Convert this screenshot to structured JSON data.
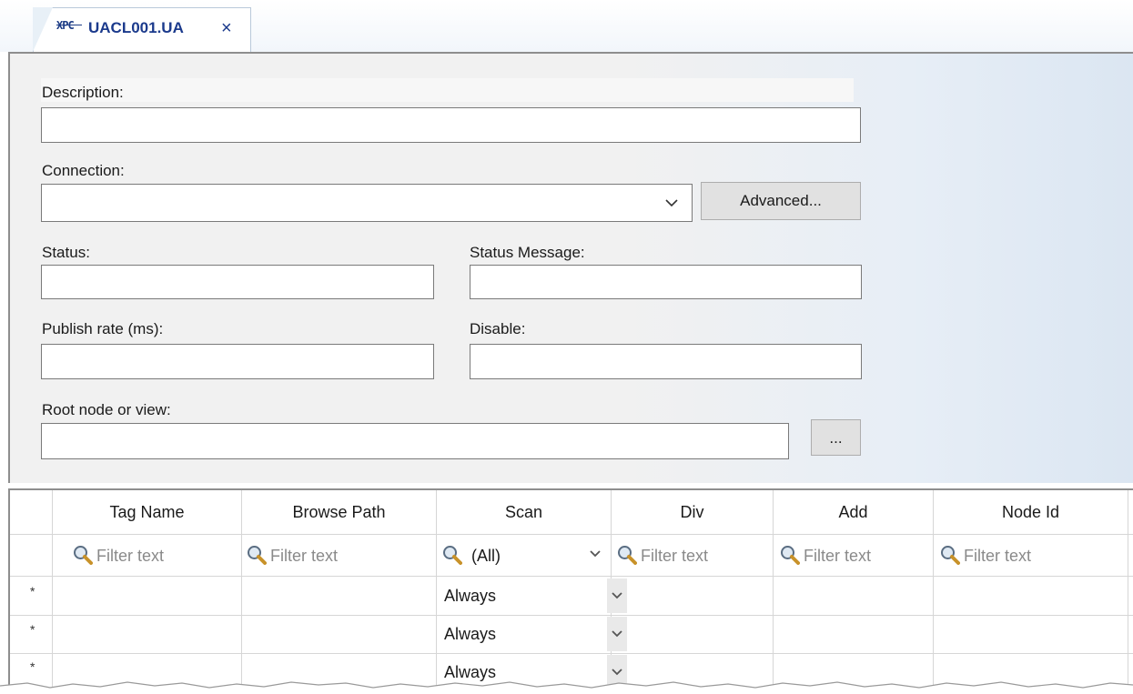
{
  "tab": {
    "logo_text": "XPC",
    "title": "UACL001.UA",
    "close_glyph": "×"
  },
  "form": {
    "description": {
      "label": "Description:",
      "value": ""
    },
    "connection": {
      "label": "Connection:",
      "value": "",
      "advanced_button": "Advanced..."
    },
    "status": {
      "label": "Status:",
      "value": ""
    },
    "status_message": {
      "label": "Status Message:",
      "value": ""
    },
    "publish_rate": {
      "label": "Publish rate (ms):",
      "value": ""
    },
    "disable": {
      "label": "Disable:",
      "value": ""
    },
    "root_node": {
      "label": "Root node or view:",
      "value": "",
      "browse_button": "..."
    }
  },
  "grid": {
    "columns": [
      "Tag Name",
      "Browse Path",
      "Scan",
      "Div",
      "Add",
      "Node Id"
    ],
    "filter_placeholder": "Filter text",
    "scan_filter_value": "(All)",
    "rows": [
      {
        "marker": "*",
        "scan": "Always"
      },
      {
        "marker": "*",
        "scan": "Always"
      },
      {
        "marker": "*",
        "scan": "Always"
      }
    ]
  },
  "icons": {
    "filter": "magnifier-icon",
    "dropdown": "chevron-down-icon",
    "close": "close-icon"
  },
  "colors": {
    "tab_text": "#1b3a8c",
    "panel_bg": "#f1f1f1",
    "button_bg": "#e1e1e1"
  }
}
